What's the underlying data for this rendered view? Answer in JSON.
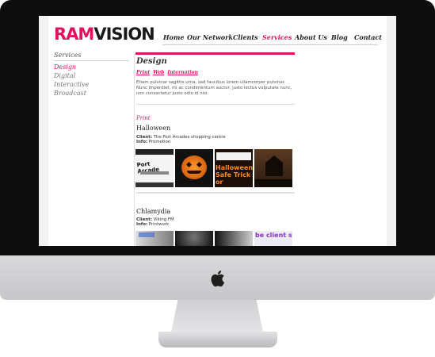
{
  "brand": {
    "part1": "RAM",
    "part2": "VISION"
  },
  "nav": {
    "items": [
      {
        "label": "Home",
        "active": false
      },
      {
        "label": "Our Network",
        "active": false
      },
      {
        "label": "Clients",
        "active": false
      },
      {
        "label": "Services",
        "active": true
      },
      {
        "label": "About Us",
        "active": false
      },
      {
        "label": "Blog",
        "active": false
      },
      {
        "label": "Contact",
        "active": false
      }
    ]
  },
  "sidebar": {
    "title": "Services",
    "items": [
      {
        "label": "Design",
        "active": true
      },
      {
        "label": "Digital",
        "active": false
      },
      {
        "label": "Interactive",
        "active": false
      },
      {
        "label": "Broadcast",
        "active": false
      }
    ]
  },
  "main": {
    "title": "Design",
    "sublinks": [
      "Print",
      "Web",
      "Internation"
    ],
    "intro": "Etiam pulvinar sagittis urna, sed faucibus lorem ullamcorper pulvinar. Nunc imperdiet, mi ac condimentum auctor, justo lectus vulputate nunc, non consectetur justo odio id nisi.",
    "section": "Print",
    "projects": [
      {
        "title": "Halloween",
        "client_label": "Client:",
        "client": "The Port Arcades shopping centre",
        "info_label": "Info:",
        "info": "Promotion",
        "thumb_texts": [
          "Port Arcade",
          "",
          "Halloween Safe Trick or",
          ""
        ]
      },
      {
        "title": "Chlamydia",
        "client_label": "Client:",
        "client": "Viking FM",
        "info_label": "Info:",
        "info": "Printwork",
        "thumb_texts": [
          "",
          "",
          "",
          "be client sti"
        ]
      }
    ]
  },
  "colors": {
    "accent": "#e0145c"
  }
}
